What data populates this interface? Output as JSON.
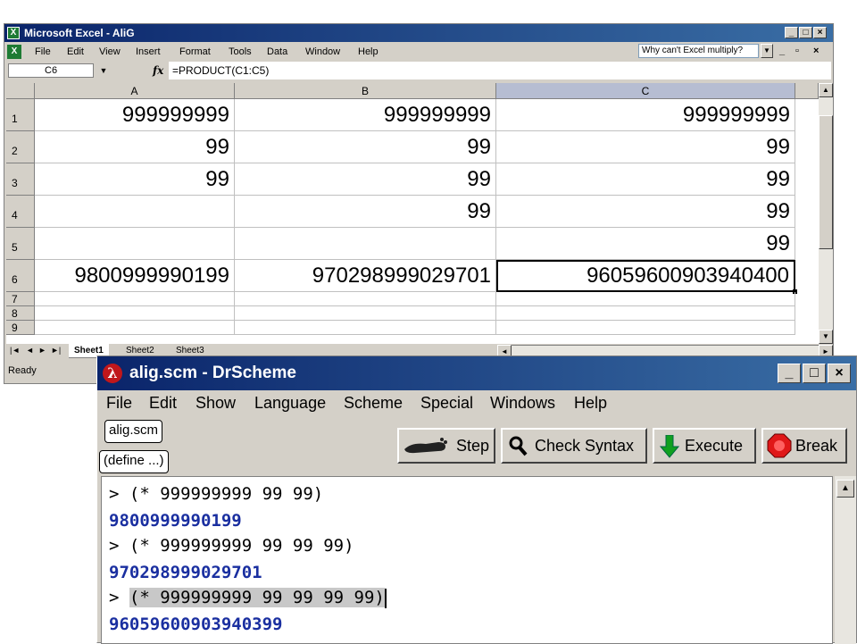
{
  "excel": {
    "title": "Microsoft Excel - AliG",
    "menu": [
      "File",
      "Edit",
      "View",
      "Insert",
      "Format",
      "Tools",
      "Data",
      "Window",
      "Help"
    ],
    "ask_box": "Why can't Excel multiply?",
    "name_box": "C6",
    "fx_label": "fx",
    "formula": "=PRODUCT(C1:C5)",
    "columns": [
      "A",
      "B",
      "C"
    ],
    "rows": [
      {
        "num": "1",
        "cells": [
          "999999999",
          "999999999",
          "999999999"
        ]
      },
      {
        "num": "2",
        "cells": [
          "99",
          "99",
          "99"
        ]
      },
      {
        "num": "3",
        "cells": [
          "99",
          "99",
          "99"
        ]
      },
      {
        "num": "4",
        "cells": [
          "",
          "99",
          "99"
        ]
      },
      {
        "num": "5",
        "cells": [
          "",
          "",
          "99"
        ]
      },
      {
        "num": "6",
        "cells": [
          "9800999990199",
          "970298999029701",
          "96059600903940400"
        ]
      },
      {
        "num": "7",
        "cells": [
          "",
          "",
          ""
        ]
      },
      {
        "num": "8",
        "cells": [
          "",
          "",
          ""
        ]
      },
      {
        "num": "9",
        "cells": [
          "",
          "",
          ""
        ]
      }
    ],
    "sheets": [
      "Sheet1",
      "Sheet2",
      "Sheet3"
    ],
    "status": "Ready"
  },
  "drscheme": {
    "title": "alig.scm - DrScheme",
    "menu": [
      "File",
      "Edit",
      "Show",
      "Language",
      "Scheme",
      "Special",
      "Windows",
      "Help"
    ],
    "file_pill": "alig.scm",
    "define_pill": "(define ...)",
    "buttons": {
      "step": "Step",
      "check_syntax": "Check Syntax",
      "execute": "Execute",
      "break": "Break"
    },
    "repl": [
      {
        "kind": "input",
        "text": "> (* 999999999 99 99)"
      },
      {
        "kind": "output",
        "text": "9800999990199"
      },
      {
        "kind": "input",
        "text": "> (* 999999999 99 99 99)"
      },
      {
        "kind": "output",
        "text": "970298999029701"
      },
      {
        "kind": "prompt",
        "text": "> "
      },
      {
        "kind": "selected",
        "text": "(* 999999999 99 99 99 99)"
      },
      {
        "kind": "output",
        "text": "96059600903940399"
      }
    ]
  }
}
